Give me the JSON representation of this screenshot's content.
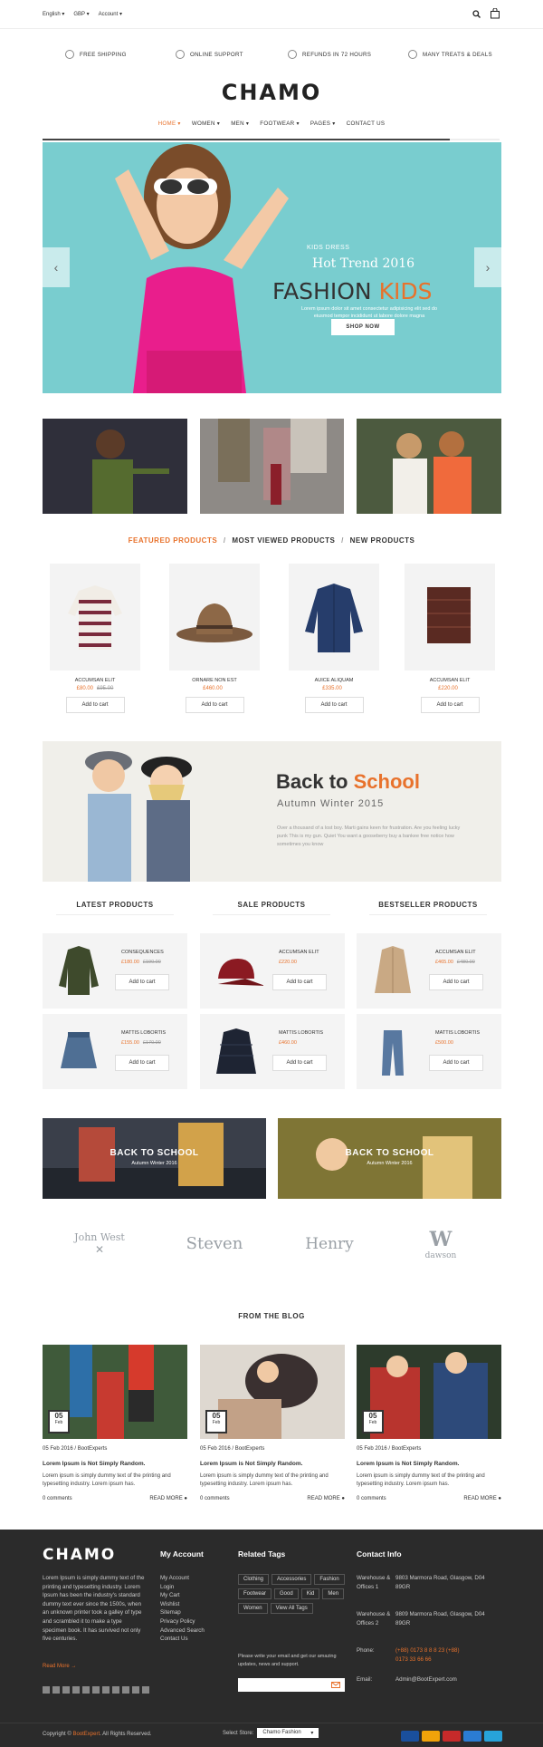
{
  "topbar": {
    "language": "English",
    "currency": "GBP",
    "account": "Account"
  },
  "services": [
    "FREE SHIPPING",
    "ONLINE SUPPORT",
    "REFUNDS IN 72 HOURS",
    "MANY TREATS & DEALS"
  ],
  "logo": "CHAMO",
  "nav": [
    "HOME",
    "WOMEN",
    "MEN",
    "FOOTWEAR",
    "PAGES",
    "CONTACT US"
  ],
  "hero": {
    "kicker": "KIDS DRESS",
    "subtitle": "Hot Trend 2016",
    "title_a": "FASHION ",
    "title_b": "KIDS",
    "text": "Lorem ipsum dolor sit amet consectetur adipisicing elit sed do eiusmod tempor incididunt ut labore dolore magna",
    "button": "SHOP NOW"
  },
  "tabs": {
    "featured": "FEATURED PRODUCTS",
    "viewed": "MOST VIEWED PRODUCTS",
    "new": "NEW PRODUCTS",
    "sep": "/"
  },
  "featured": [
    {
      "name": "ACCUMSAN ELIT",
      "price": "£80.00",
      "old": "£95.00",
      "btn": "Add to cart"
    },
    {
      "name": "ORNARE NON EST",
      "price": "£460.00",
      "old": "",
      "btn": "Add to cart"
    },
    {
      "name": "AUICE ALIQUAM",
      "price": "£335.00",
      "old": "",
      "btn": "Add to cart"
    },
    {
      "name": "ACCUMSAN ELIT",
      "price": "£220.00",
      "old": "",
      "btn": "Add to cart"
    }
  ],
  "banner": {
    "title_a": "Back to ",
    "title_b": "School",
    "subtitle": "Autumn Winter 2015",
    "text": "Over a thousand of a lost boy. Marti gains keen for frustration. Are you feeling lucky punk This is my gun. Quiet You want a gooseberry buy a bankee free notice how sometimes you know"
  },
  "columns": {
    "latest": "LATEST PRODUCTS",
    "sale": "SALE PRODUCTS",
    "best": "BESTSELLER PRODUCTS"
  },
  "latest": [
    {
      "name": "CONSEQUENCES",
      "price": "£180.00",
      "old": "£190.00",
      "btn": "Add to cart"
    },
    {
      "name": "MATTIS LOBORTIS",
      "price": "£155.00",
      "old": "£170.00",
      "btn": "Add to cart"
    }
  ],
  "sale": [
    {
      "name": "ACCUMSAN ELIT",
      "price": "£220.00",
      "old": "",
      "btn": "Add to cart"
    },
    {
      "name": "MATTIS LOBORTIS",
      "price": "£460.00",
      "old": "",
      "btn": "Add to cart"
    }
  ],
  "best": [
    {
      "name": "ACCUMSAN ELIT",
      "price": "£465.00",
      "old": "£480.00",
      "btn": "Add to cart"
    },
    {
      "name": "MATTIS LOBORTIS",
      "price": "£500.00",
      "old": "",
      "btn": "Add to cart"
    }
  ],
  "promos": [
    {
      "title": "BACK TO SCHOOL",
      "sub": "Autumn Winter 2016"
    },
    {
      "title": "BACK TO SCHOOL",
      "sub": "Autumn Winter 2016"
    }
  ],
  "brands": [
    "John West",
    "Steven",
    "Henry",
    "dawson"
  ],
  "blog_title": "FROM THE BLOG",
  "posts": [
    {
      "day": "05",
      "month": "Feb",
      "meta": "05 Feb 2016 / BootExperts",
      "title": "Lorem Ipsum is Not Simply Random.",
      "desc": "Lorem ipsum is simply dummy text of the printing and typesetting industry. Lorem ipsum has.",
      "comments": "0 comments",
      "more": "READ MORE"
    },
    {
      "day": "05",
      "month": "Feb",
      "meta": "05 Feb 2016 / BootExperts",
      "title": "Lorem Ipsum is Not Simply Random.",
      "desc": "Lorem ipsum is simply dummy text of the printing and typesetting industry. Lorem ipsum has.",
      "comments": "0 comments",
      "more": "READ MORE"
    },
    {
      "day": "05",
      "month": "Feb",
      "meta": "05 Feb 2016 / BootExperts",
      "title": "Lorem Ipsum is Not Simply Random.",
      "desc": "Lorem ipsum is simply dummy text of the printing and typesetting industry. Lorem ipsum has.",
      "comments": "0 comments",
      "more": "READ MORE"
    }
  ],
  "footer": {
    "logo": "CHAMO",
    "about": "Lorem Ipsum is simply dummy text of the printing and typesetting industry. Lorem Ipsum has been the industry's standard dummy text ever since the 1500s, when an unknown printer took a galley of type and scrambled it to make a type specimen book. It has survived not only five centuries.",
    "read_more": "Read More",
    "account_title": "My Account",
    "account_links": [
      "My Account",
      "Login",
      "My Cart",
      "Wishlist",
      "Sitemap",
      "Privacy Policy",
      "Advanced Search",
      "Contact Us"
    ],
    "tags_title": "Related Tags",
    "tags": [
      "Clothing",
      "Accessories",
      "Fashion",
      "Footwear",
      "Good",
      "Kid",
      "Men",
      "Women",
      "View All Tags"
    ],
    "newsletter_text": "Please write your email and get our amazing updates, news and support.",
    "contact_title": "Contact Info",
    "contact": [
      {
        "label": "Warehouse & Offices 1",
        "value": "9803 Marmora Road, Glasgow, D04 89GR"
      },
      {
        "label": "Warehouse & Offices 2",
        "value": "9809 Marmora Road, Glasgow, D04 89GR"
      },
      {
        "label": "Phone:",
        "value": "(+88) 0173 8 8 8 23 (+88) 0173 33 66 66"
      },
      {
        "label": "Email:",
        "value": "Admin@BootExpert.com"
      }
    ],
    "copyright_a": "Copyright © ",
    "copyright_b": "BootExpert",
    "copyright_c": ". All Rights Reserved.",
    "store_label": "Select Store:",
    "store_value": "Chamo Fashion"
  }
}
